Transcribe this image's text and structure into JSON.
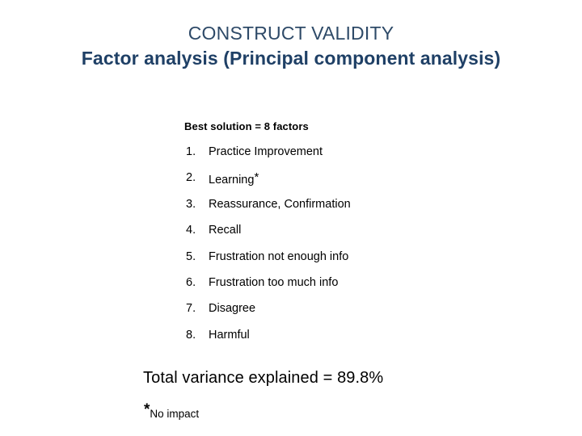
{
  "slide": {
    "title_line_1": "CONSTRUCT VALIDITY",
    "title_line_2": "Factor analysis (Principal component analysis)",
    "title_color": "#2E4A68",
    "subtitle_color": "#1F4066",
    "background_color": "#FFFFFF"
  },
  "content": {
    "lead": "Best solution = 8 factors",
    "factors": [
      {
        "number": "1.",
        "label": "Practice Improvement"
      },
      {
        "number": "2.",
        "label": "Learning",
        "marker": "*"
      },
      {
        "number": "3.",
        "label": "Reassurance, Confirmation"
      },
      {
        "number": "4.",
        "label": "Recall"
      },
      {
        "number": "5.",
        "label": "Frustration not enough info"
      },
      {
        "number": "6.",
        "label": "Frustration too much info"
      },
      {
        "number": "7.",
        "label": "Disagree"
      },
      {
        "number": "8.",
        "label": "Harmful"
      }
    ],
    "total_variance": "Total variance explained = 89.8%",
    "footnote_marker": "*",
    "footnote_text": "No impact"
  }
}
